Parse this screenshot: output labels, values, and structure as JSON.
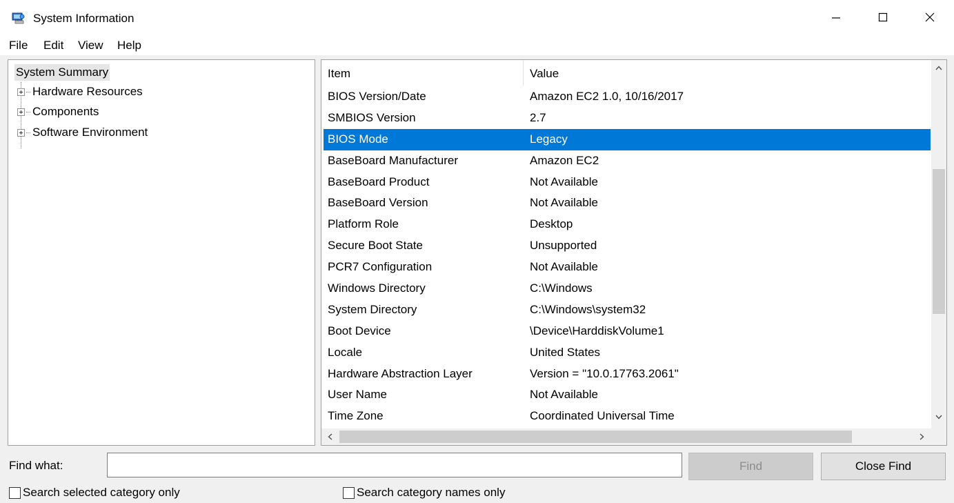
{
  "window": {
    "title": "System Information",
    "icon": "system-information-icon",
    "controls": {
      "minimize": "minimize-icon",
      "maximize": "maximize-icon",
      "close": "close-icon"
    }
  },
  "menu": [
    "File",
    "Edit",
    "View",
    "Help"
  ],
  "tree": {
    "root": "System Summary",
    "children": [
      "Hardware Resources",
      "Components",
      "Software Environment"
    ]
  },
  "list": {
    "columns": {
      "item": "Item",
      "value": "Value"
    },
    "selected_index": 2,
    "rows": [
      {
        "item": "BIOS Version/Date",
        "value": "Amazon EC2 1.0, 10/16/2017"
      },
      {
        "item": "SMBIOS Version",
        "value": "2.7"
      },
      {
        "item": "BIOS Mode",
        "value": "Legacy"
      },
      {
        "item": "BaseBoard Manufacturer",
        "value": "Amazon EC2"
      },
      {
        "item": "BaseBoard Product",
        "value": "Not Available"
      },
      {
        "item": "BaseBoard Version",
        "value": "Not Available"
      },
      {
        "item": "Platform Role",
        "value": "Desktop"
      },
      {
        "item": "Secure Boot State",
        "value": "Unsupported"
      },
      {
        "item": "PCR7 Configuration",
        "value": "Not Available"
      },
      {
        "item": "Windows Directory",
        "value": "C:\\Windows"
      },
      {
        "item": "System Directory",
        "value": "C:\\Windows\\system32"
      },
      {
        "item": "Boot Device",
        "value": "\\Device\\HarddiskVolume1"
      },
      {
        "item": "Locale",
        "value": "United States"
      },
      {
        "item": "Hardware Abstraction Layer",
        "value": "Version = \"10.0.17763.2061\""
      },
      {
        "item": "User Name",
        "value": "Not Available"
      },
      {
        "item": "Time Zone",
        "value": "Coordinated Universal Time"
      }
    ]
  },
  "find": {
    "label": "Find what:",
    "value": "",
    "find_button": "Find",
    "close_button": "Close Find",
    "check_selected": "Search selected category only",
    "check_names": "Search category names only"
  },
  "colors": {
    "selection": "#0078d7"
  }
}
